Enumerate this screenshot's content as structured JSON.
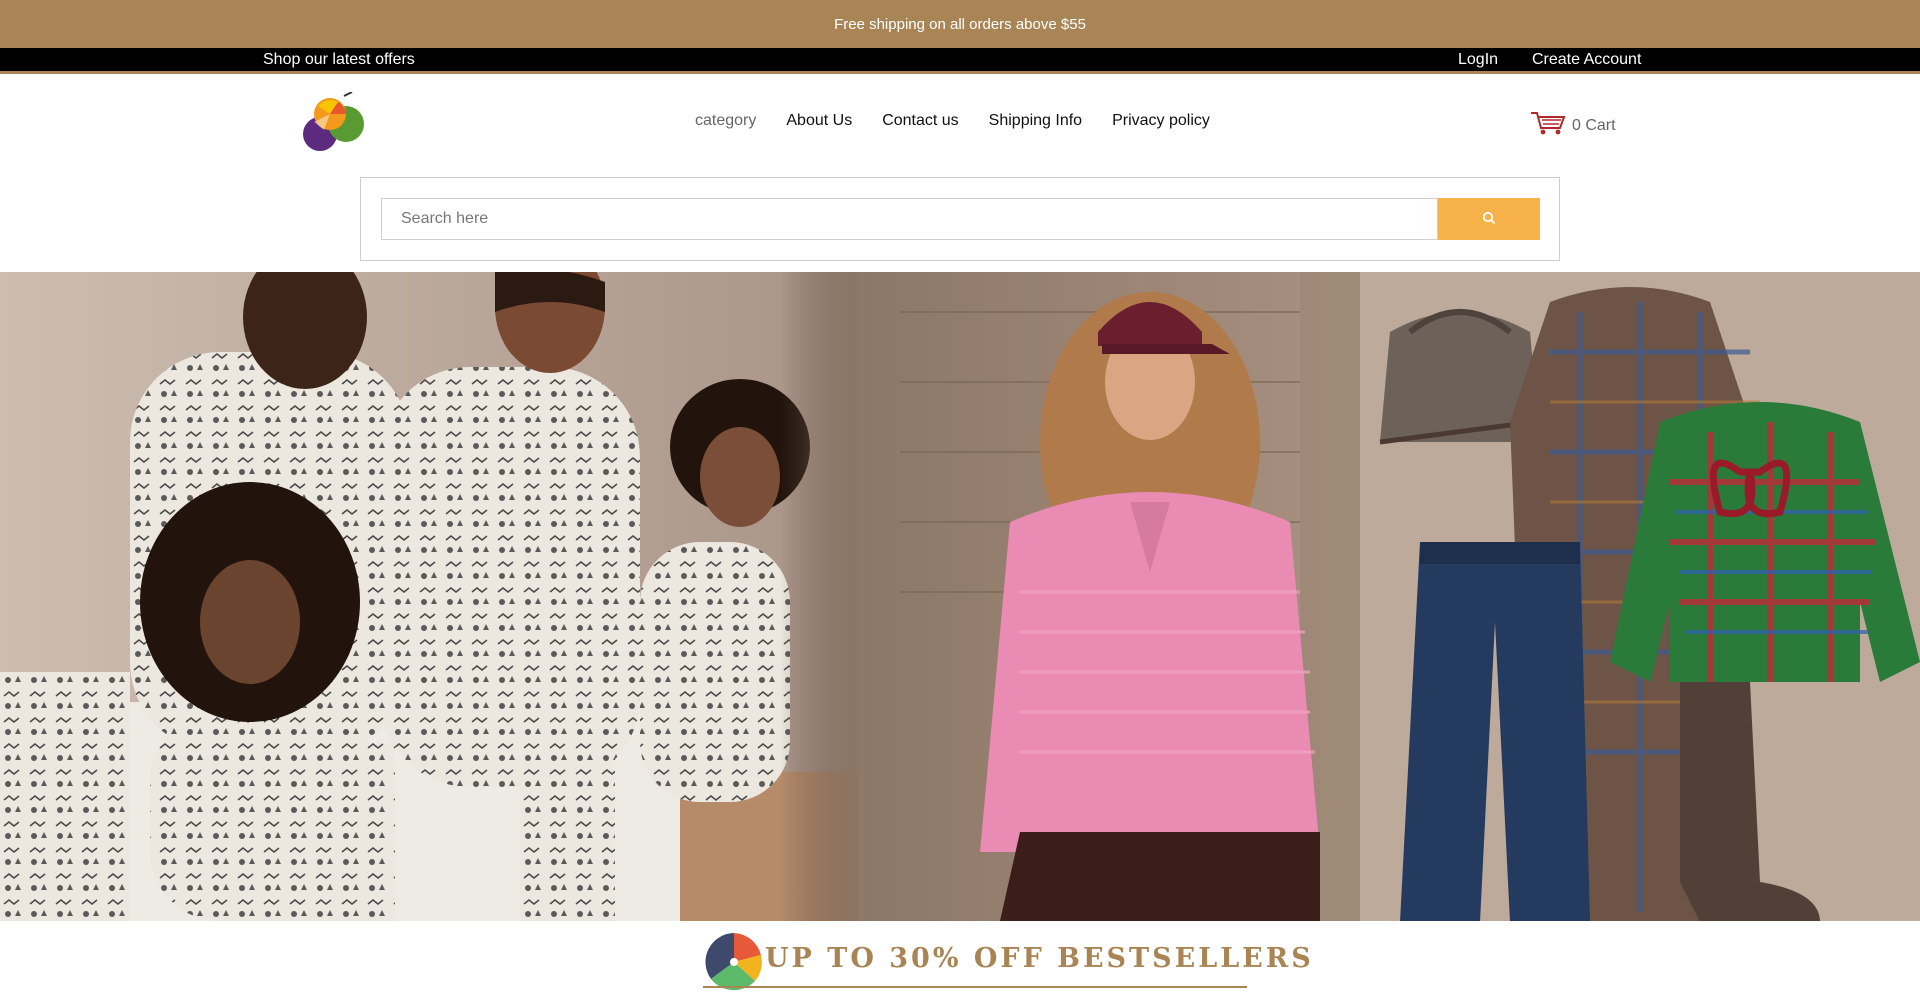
{
  "announcement": "Free shipping on all orders above $55",
  "topbar": {
    "offer_link": "Shop our latest offers",
    "login": "LogIn",
    "create_account": "Create Account"
  },
  "nav": {
    "items": [
      "category",
      "About Us",
      "Contact us",
      "Shipping Info",
      "Privacy policy"
    ]
  },
  "cart": {
    "label": "0 Cart",
    "icon": "shopping-cart-icon"
  },
  "search": {
    "placeholder": "Search here",
    "button_icon": "search-icon"
  },
  "promo": {
    "title": "UP TO 30% OFF BESTSELLERS"
  },
  "colors": {
    "brand": "#a98454",
    "search_button": "#f8b24a",
    "topbar": "#000000"
  }
}
